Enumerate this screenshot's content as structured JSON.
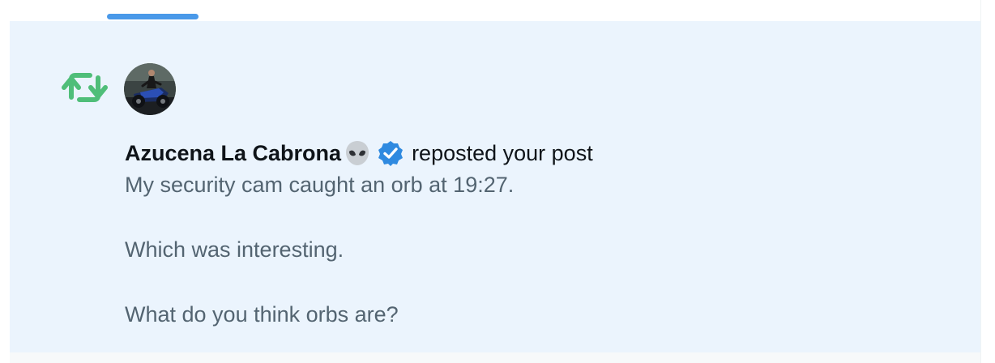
{
  "notification": {
    "type_icon": "repost-icon",
    "avatar_icon": "avatar",
    "user_name": "Azucena La Cabrona",
    "name_emoji_icon": "alien-emoji-icon",
    "verified_icon": "verified-badge-icon",
    "action_text": "reposted your post",
    "post_lines": [
      "My security cam caught an orb at 19:27.",
      "Which was interesting.",
      "What do you think orbs are?"
    ]
  },
  "colors": {
    "notification_background": "#ebf4fd",
    "tab_indicator": "#4a99e9",
    "repost_green": "#4fbe79",
    "verified_blue": "#2f8ae0",
    "primary_text": "#0f1419",
    "secondary_text": "#536471"
  }
}
